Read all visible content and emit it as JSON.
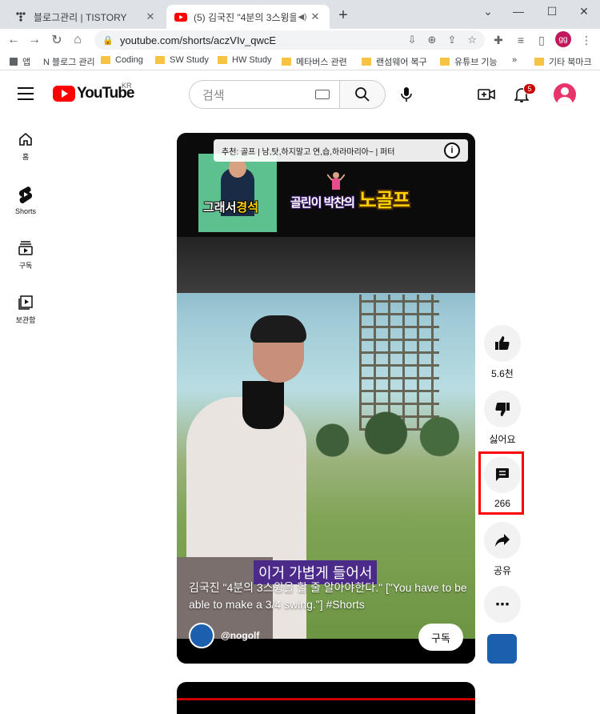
{
  "browser": {
    "tabs": [
      {
        "title": "블로그관리 | TISTORY",
        "close": "✕"
      },
      {
        "title": "(5) 김국진 \"4분의 3스윙을 할",
        "close": "✕"
      }
    ],
    "new_tab": "+",
    "window_controls": [
      "⌄",
      "—",
      "☐",
      "✕"
    ],
    "url": "youtube.com/shorts/aczVIv_qwcE",
    "profile_initials": "gg",
    "bookmarks": [
      "앱",
      "N 블로그 관리",
      "Coding",
      "SW Study",
      "HW Study",
      "메타버스 관련",
      "랜섬웨어 복구",
      "유튜브 기능",
      "»",
      "기타 북마크"
    ]
  },
  "header": {
    "logo_text": "YouTube",
    "logo_region": "KR",
    "search_placeholder": "검색",
    "notification_count": "5"
  },
  "sidebar": {
    "items": [
      {
        "label": "홈",
        "icon": "home-icon"
      },
      {
        "label": "Shorts",
        "icon": "shorts-icon"
      },
      {
        "label": "구독",
        "icon": "subscriptions-icon"
      },
      {
        "label": "보관함",
        "icon": "library-icon"
      }
    ]
  },
  "player": {
    "recommendation": "추천: 골프 | 남,탓,하지말고 연,습,하라마리아~ | 퍼터",
    "thumb_label_white": "그래서",
    "thumb_label_yellow": "경석",
    "title_art_small": "골린이 박찬의",
    "title_art_big": "노골프",
    "caption": "이거 가볍게 들어서",
    "title": "김국진 \"4분의 3스윙을 할 줄 알아야한다.\" [\"You have to be able to make a 3/4 swing.\"] #Shorts",
    "channel": "@nogolf",
    "subscribe_label": "구독"
  },
  "actions": {
    "like_count": "5.6천",
    "dislike_label": "싫어요",
    "comment_count": "266",
    "share_label": "공유",
    "more_label": "⋯"
  },
  "colors": {
    "youtube_red": "#ff0000",
    "highlight": "#ff0000",
    "caption_bg": "#4b2a8a"
  }
}
